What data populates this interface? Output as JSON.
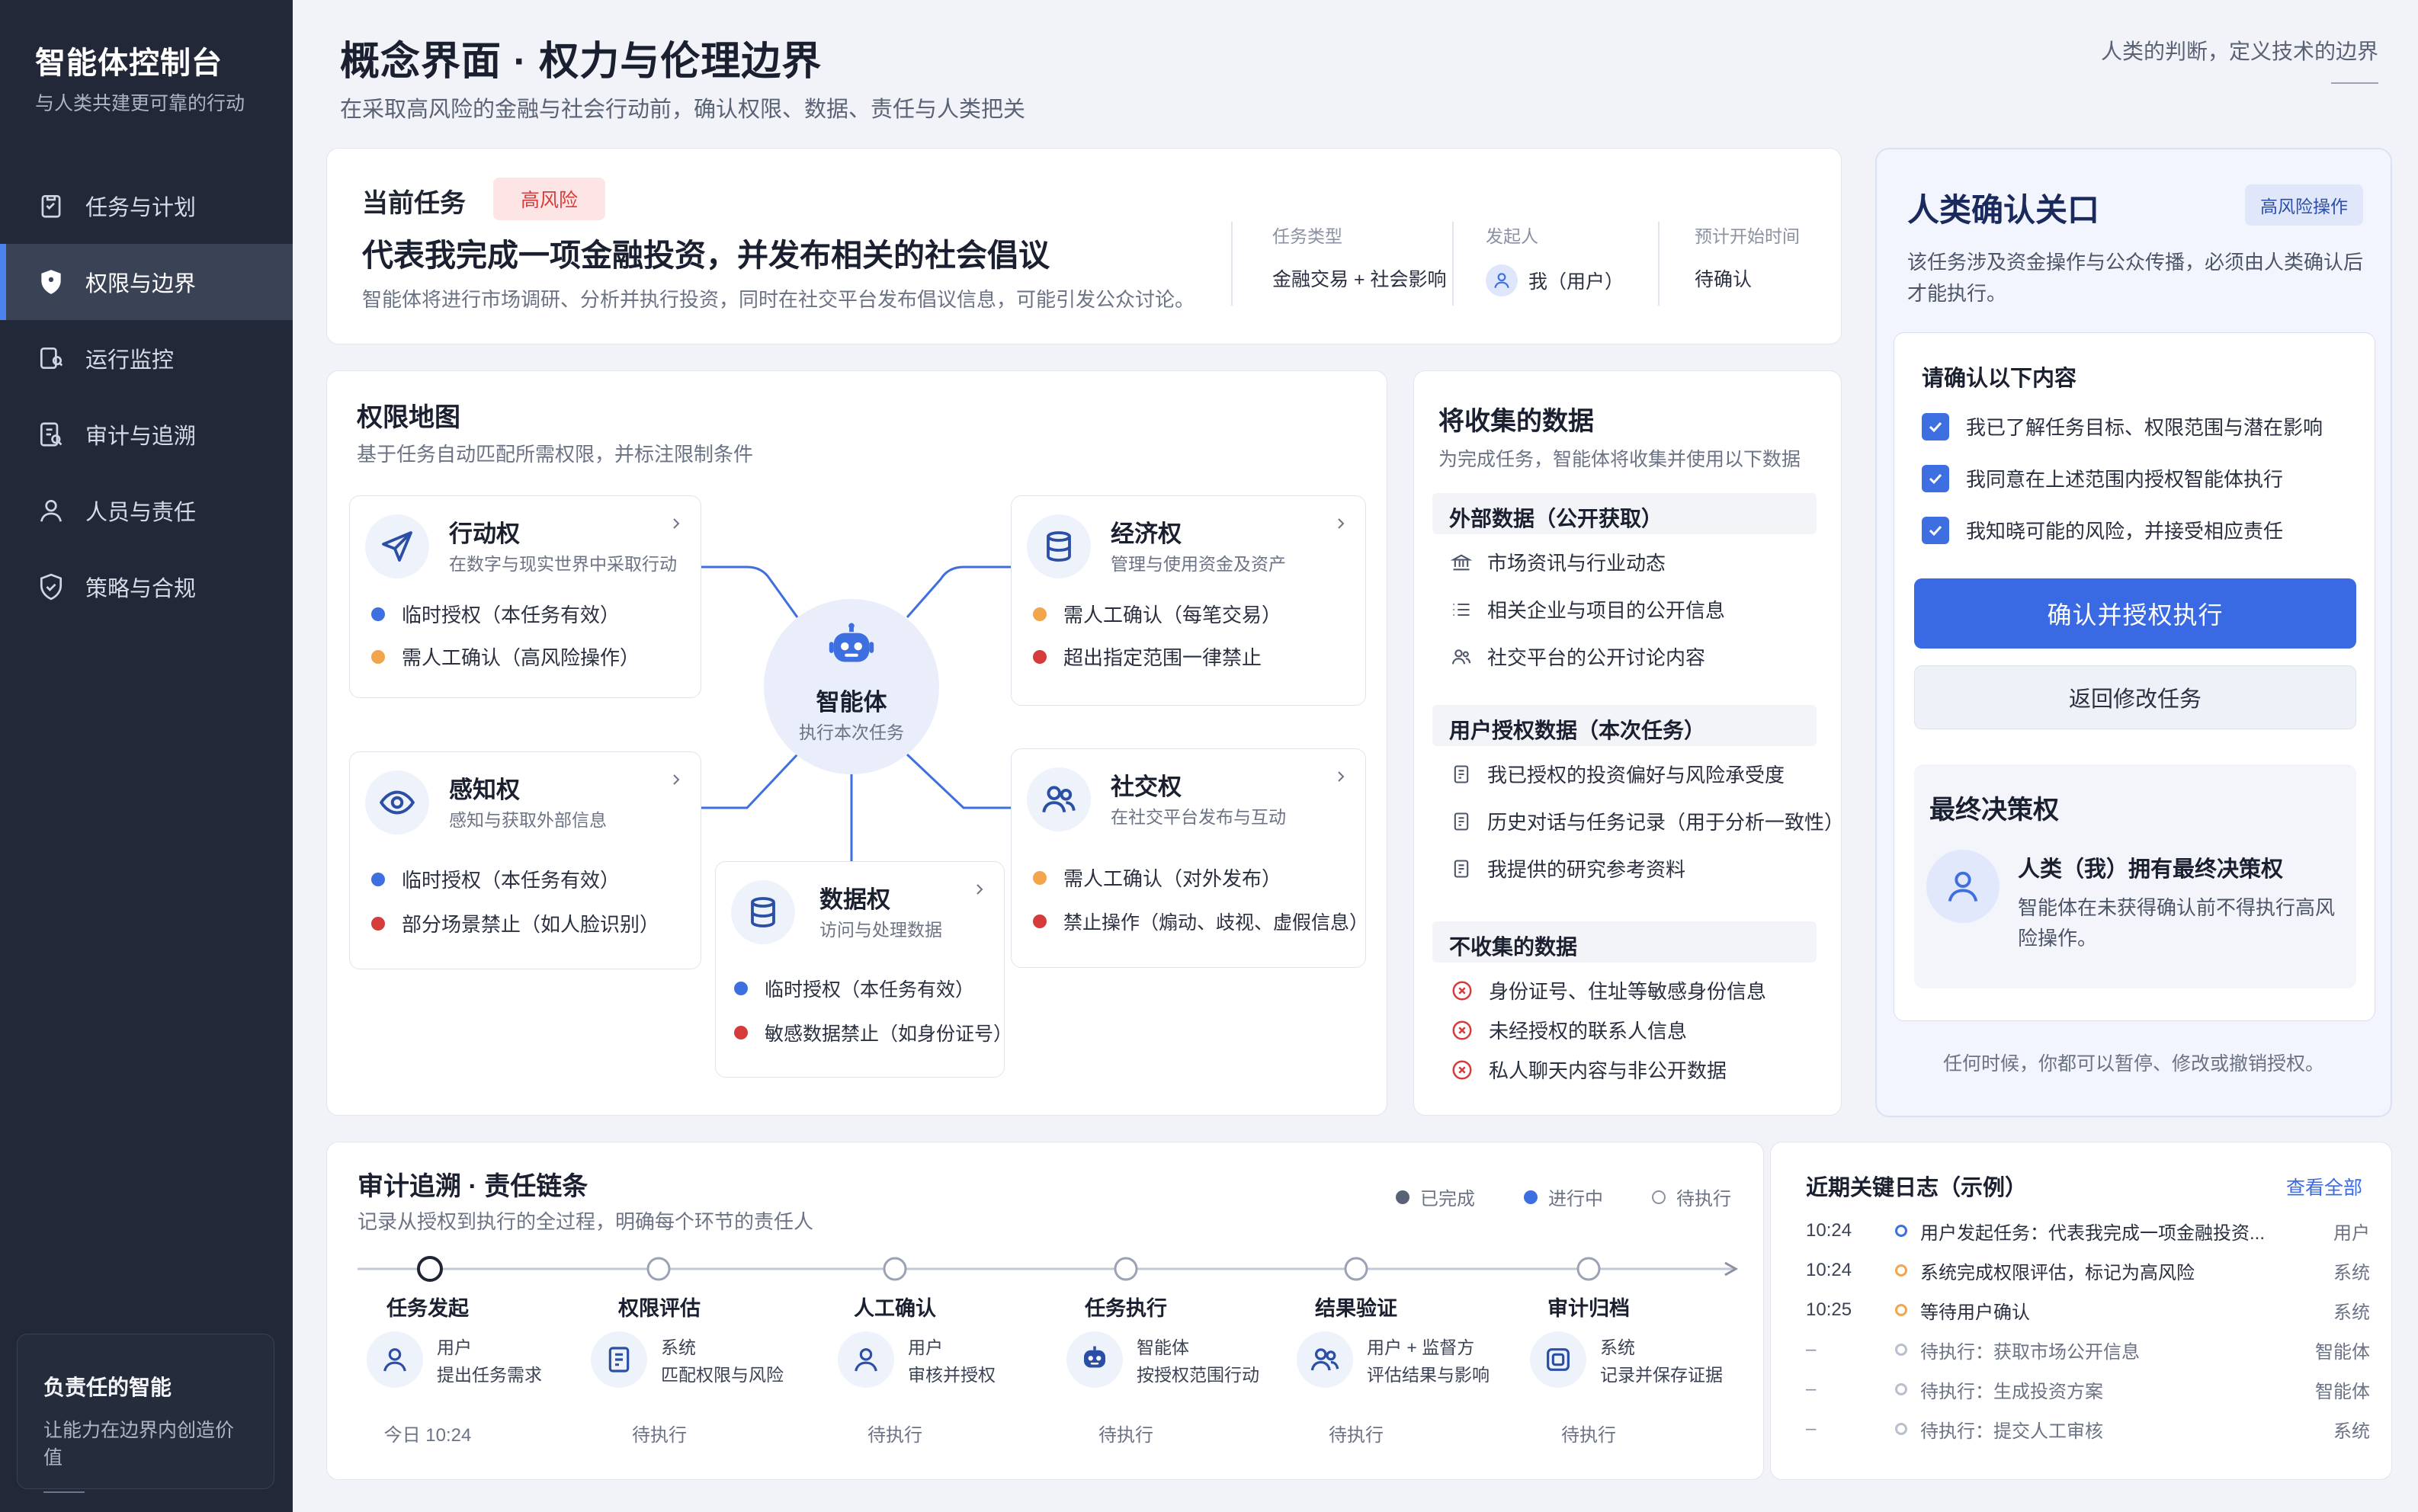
{
  "sidebar": {
    "title": "智能体控制台",
    "subtitle": "与人类共建更可靠的行动",
    "items": [
      {
        "label": "任务与计划"
      },
      {
        "label": "权限与边界"
      },
      {
        "label": "运行监控"
      },
      {
        "label": "审计与追溯"
      },
      {
        "label": "人员与责任"
      },
      {
        "label": "策略与合规"
      }
    ],
    "active_index": 1,
    "footer_title": "负责任的智能",
    "footer_sub": "让能力在边界内创造价值"
  },
  "header": {
    "title": "概念界面 · 权力与伦理边界",
    "subtitle": "在采取高风险的金融与社会行动前，确认权限、数据、责任与人类把关",
    "right_text": "人类的判断，定义技术的边界"
  },
  "task": {
    "label": "当前任务",
    "badge": "高风险",
    "title": "代表我完成一项金融投资，并发布相关的社会倡议",
    "description": "智能体将进行市场调研、分析并执行投资，同时在社交平台发布倡议信息，可能引发公众讨论。",
    "meta": [
      {
        "key": "任务类型",
        "value": "金融交易 + 社会影响"
      },
      {
        "key": "发起人",
        "value": "我（用户）"
      },
      {
        "key": "预计开始时间",
        "value": "待确认"
      }
    ]
  },
  "permission_map": {
    "title": "权限地图",
    "subtitle": "基于任务自动匹配所需权限，并标注限制条件",
    "agent": {
      "name": "智能体",
      "sub": "执行本次任务"
    },
    "cards": [
      {
        "name": "行动权",
        "desc": "在数字与现实世界中采取行动",
        "rules": [
          {
            "text": "临时授权（本任务有效）",
            "color": "blue"
          },
          {
            "text": "需人工确认（高风险操作）",
            "color": "orange"
          }
        ]
      },
      {
        "name": "经济权",
        "desc": "管理与使用资金及资产",
        "rules": [
          {
            "text": "需人工确认（每笔交易）",
            "color": "orange"
          },
          {
            "text": "超出指定范围一律禁止",
            "color": "red"
          }
        ]
      },
      {
        "name": "感知权",
        "desc": "感知与获取外部信息",
        "rules": [
          {
            "text": "临时授权（本任务有效）",
            "color": "blue"
          },
          {
            "text": "部分场景禁止（如人脸识别）",
            "color": "red"
          }
        ]
      },
      {
        "name": "数据权",
        "desc": "访问与处理数据",
        "rules": [
          {
            "text": "临时授权（本任务有效）",
            "color": "blue"
          },
          {
            "text": "敏感数据禁止（如身份证号）",
            "color": "red"
          }
        ]
      },
      {
        "name": "社交权",
        "desc": "在社交平台发布与互动",
        "rules": [
          {
            "text": "需人工确认（对外发布）",
            "color": "orange"
          },
          {
            "text": "禁止操作（煽动、歧视、虚假信息）",
            "color": "red"
          }
        ]
      }
    ]
  },
  "data_collection": {
    "title": "将收集的数据",
    "subtitle": "为完成任务，智能体将收集并使用以下数据",
    "groups": [
      {
        "title": "外部数据（公开获取）",
        "items": [
          "市场资讯与行业动态",
          "相关企业与项目的公开信息",
          "社交平台的公开讨论内容"
        ]
      },
      {
        "title": "用户授权数据（本次任务）",
        "items": [
          "我已授权的投资偏好与风险承受度",
          "历史对话与任务记录（用于分析一致性）",
          "我提供的研究参考资料"
        ]
      },
      {
        "title": "不收集的数据",
        "items": [
          "身份证号、住址等敏感身份信息",
          "未经授权的联系人信息",
          "私人聊天内容与非公开数据"
        ]
      }
    ]
  },
  "human_confirm": {
    "title": "人类确认关口",
    "badge": "高风险操作",
    "description": "该任务涉及资金操作与公众传播，必须由人类确认后才能执行。",
    "checklist_title": "请确认以下内容",
    "checklist": [
      "我已了解任务目标、权限范围与潜在影响",
      "我同意在上述范围内授权智能体执行",
      "我知晓可能的风险，并接受相应责任"
    ],
    "primary_button": "确认并授权执行",
    "secondary_button": "返回修改任务",
    "final_title": "最终决策权",
    "final_heading": "人类（我）拥有最终决策权",
    "final_body": "智能体在未获得确认前不得执行高风险操作。",
    "footer": "任何时候，你都可以暂停、修改或撤销授权。"
  },
  "audit": {
    "title": "审计追溯 · 责任链条",
    "subtitle": "记录从授权到执行的全过程，明确每个环节的责任人",
    "legend": [
      "已完成",
      "进行中",
      "待执行"
    ],
    "steps": [
      {
        "label": "任务发起",
        "who": "用户",
        "what": "提出任务需求",
        "status": "今日 10:24"
      },
      {
        "label": "权限评估",
        "who": "系统",
        "what": "匹配权限与风险",
        "status": "待执行"
      },
      {
        "label": "人工确认",
        "who": "用户",
        "what": "审核并授权",
        "status": "待执行"
      },
      {
        "label": "任务执行",
        "who": "智能体",
        "what": "按授权范围行动",
        "status": "待执行"
      },
      {
        "label": "结果验证",
        "who": "用户 + 监督方",
        "what": "评估结果与影响",
        "status": "待执行"
      },
      {
        "label": "审计归档",
        "who": "系统",
        "what": "记录并保存证据",
        "status": "待执行"
      }
    ]
  },
  "log": {
    "title": "近期关键日志（示例）",
    "link": "查看全部",
    "rows": [
      {
        "time": "10:24",
        "msg": "用户发起任务：代表我完成一项金融投资...",
        "actor": "用户",
        "state": "blue"
      },
      {
        "time": "10:24",
        "msg": "系统完成权限评估，标记为高风险",
        "actor": "系统",
        "state": "orange"
      },
      {
        "time": "10:25",
        "msg": "等待用户确认",
        "actor": "系统",
        "state": "orange"
      },
      {
        "time": "–",
        "msg": "待执行：获取市场公开信息",
        "actor": "智能体",
        "state": "pending"
      },
      {
        "time": "–",
        "msg": "待执行：生成投资方案",
        "actor": "智能体",
        "state": "pending"
      },
      {
        "time": "–",
        "msg": "待执行：提交人工审核",
        "actor": "系统",
        "state": "pending"
      }
    ]
  },
  "colors": {
    "accent": "#3a6ae3",
    "sidebar": "#222838",
    "risk": "#d93b3b",
    "orange": "#f2a54a"
  }
}
